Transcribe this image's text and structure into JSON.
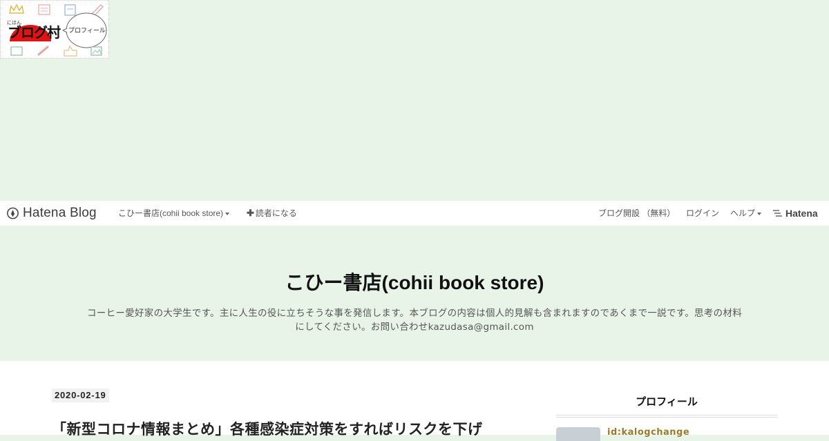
{
  "banner": {
    "small_text": "にほん",
    "logo_text": "ブログ村",
    "bubble_text": "プロフィール"
  },
  "header": {
    "logo_text": "Hatena Blog",
    "blog_menu_label": "こひー書店(cohii book store)",
    "subscribe_label": "読者になる",
    "signup_label": "ブログ開設 （無料）",
    "login_label": "ログイン",
    "help_label": "ヘルプ",
    "brand_label": "Hatena"
  },
  "blog": {
    "title": "こひー書店(cohii book store)",
    "description": "コーヒー愛好家の大学生です。主に人生の役に立ちそうな事を発信します。本ブログの内容は個人的見解も含まれますのであくまで一説です。思考の材料にしてください。お問い合わせkazudasa@gmail.com"
  },
  "entry": {
    "date": "2020-02-19",
    "title": "「新型コロナ情報まとめ」各種感染症対策をすればリスクを下げ"
  },
  "sidebar": {
    "profile_title": "プロフィール",
    "profile_id": "id:kalogchange"
  },
  "colors": {
    "page_background": "#e9f4e9",
    "header_background": "#ffffff",
    "accent_gold": "#9a7b2a"
  }
}
